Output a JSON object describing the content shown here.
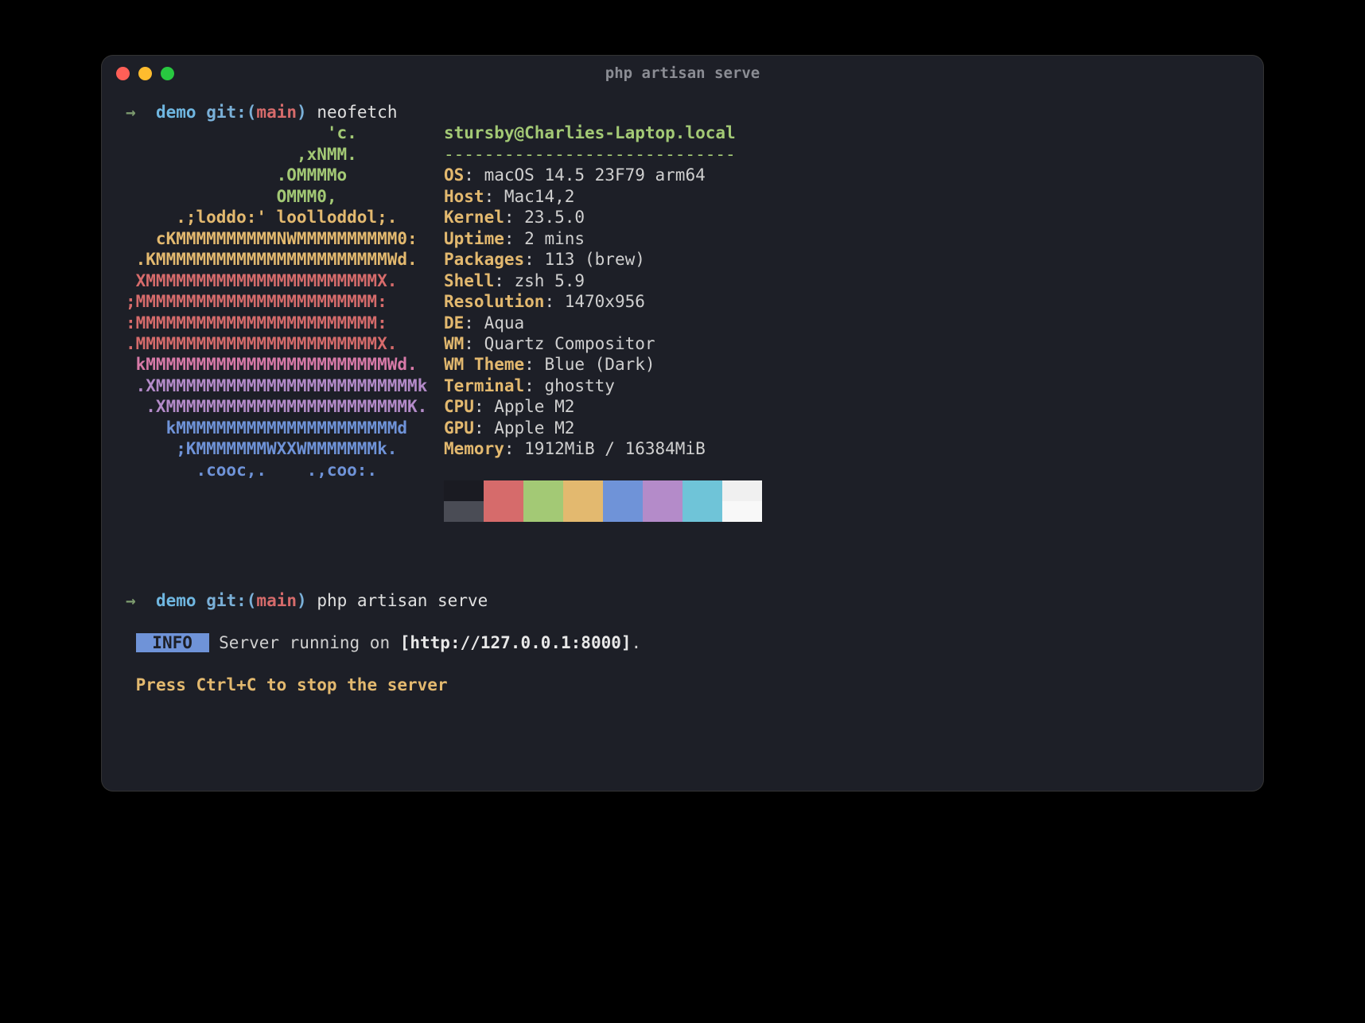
{
  "window": {
    "title": "php artisan serve"
  },
  "prompt1": {
    "arrow": "→",
    "dir": "demo",
    "git_label": "git:",
    "paren_open": "(",
    "branch": "main",
    "paren_close": ")",
    "command": "neofetch"
  },
  "neofetch": {
    "ascii_lines": [
      {
        "text": "                    'c.",
        "color": "green"
      },
      {
        "text": "                 ,xNMM.",
        "color": "green"
      },
      {
        "text": "               .OMMMMo",
        "color": "green"
      },
      {
        "text": "               OMMM0,",
        "color": "green"
      },
      {
        "text": "     .;loddo:' loolloddol;.",
        "color": "yellow"
      },
      {
        "text": "   cKMMMMMMMMMMNWMMMMMMMMMM0:",
        "color": "yellow"
      },
      {
        "text": " .KMMMMMMMMMMMMMMMMMMMMMMMWd.",
        "color": "yellow"
      },
      {
        "text": " XMMMMMMMMMMMMMMMMMMMMMMMX.",
        "color": "red"
      },
      {
        "text": ";MMMMMMMMMMMMMMMMMMMMMMMM:",
        "color": "red"
      },
      {
        "text": ":MMMMMMMMMMMMMMMMMMMMMMMM:",
        "color": "red"
      },
      {
        "text": ".MMMMMMMMMMMMMMMMMMMMMMMMX.",
        "color": "red"
      },
      {
        "text": " kMMMMMMMMMMMMMMMMMMMMMMMMWd.",
        "color": "pink"
      },
      {
        "text": " .XMMMMMMMMMMMMMMMMMMMMMMMMMMk",
        "color": "purple"
      },
      {
        "text": "  .XMMMMMMMMMMMMMMMMMMMMMMMMK.",
        "color": "purple"
      },
      {
        "text": "    kMMMMMMMMMMMMMMMMMMMMMMd",
        "color": "blue"
      },
      {
        "text": "     ;KMMMMMMMWXXWMMMMMMMk.",
        "color": "blue"
      },
      {
        "text": "       .cooc,.    .,coo:.",
        "color": "blue"
      }
    ],
    "user_host": "stursby@Charlies-Laptop.local",
    "divider": "-----------------------------",
    "info": [
      {
        "key": "OS",
        "value": "macOS 14.5 23F79 arm64"
      },
      {
        "key": "Host",
        "value": "Mac14,2"
      },
      {
        "key": "Kernel",
        "value": "23.5.0"
      },
      {
        "key": "Uptime",
        "value": "2 mins"
      },
      {
        "key": "Packages",
        "value": "113 (brew)"
      },
      {
        "key": "Shell",
        "value": "zsh 5.9"
      },
      {
        "key": "Resolution",
        "value": "1470x956"
      },
      {
        "key": "DE",
        "value": "Aqua"
      },
      {
        "key": "WM",
        "value": "Quartz Compositor"
      },
      {
        "key": "WM Theme",
        "value": "Blue (Dark)"
      },
      {
        "key": "Terminal",
        "value": "ghostty"
      },
      {
        "key": "CPU",
        "value": "Apple M2"
      },
      {
        "key": "GPU",
        "value": "Apple M2"
      },
      {
        "key": "Memory",
        "value": "1912MiB / 16384MiB"
      }
    ],
    "swatches_row1": [
      "#1a1b22",
      "#d66b6b",
      "#a3c975",
      "#e3b96f",
      "#6f93d8",
      "#b48bc9",
      "#6fc4d8",
      "#f0f0f0"
    ],
    "swatches_row2": [
      "#4a4c55",
      "#d66b6b",
      "#a3c975",
      "#e3b96f",
      "#6f93d8",
      "#b48bc9",
      "#6fc4d8",
      "#f8f8f8"
    ]
  },
  "prompt2": {
    "arrow": "→",
    "dir": "demo",
    "git_label": "git:",
    "paren_open": "(",
    "branch": "main",
    "paren_close": ")",
    "command": "php artisan serve"
  },
  "server": {
    "badge": " INFO ",
    "text_prefix": " Server running on ",
    "url_bracket": "[http://127.0.0.1:8000]",
    "text_suffix": ".",
    "stop": "Press Ctrl+C to stop the server"
  }
}
